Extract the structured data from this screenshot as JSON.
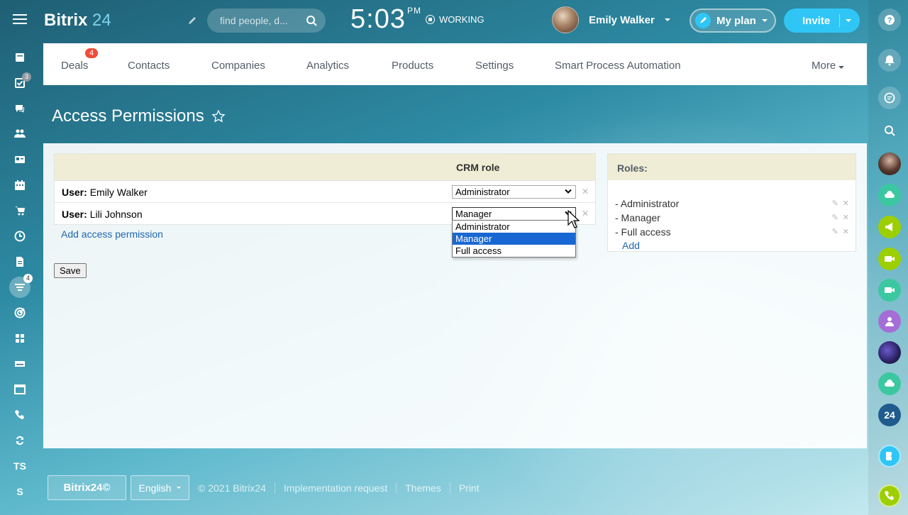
{
  "app": {
    "logo_main": "Bitrix",
    "logo_num": "24"
  },
  "header": {
    "search_placeholder": "find people, d...",
    "clock_time": "5:03",
    "clock_ampm": "PM",
    "work_status": "WORKING",
    "user_name": "Emily Walker",
    "myplan_label": "My plan",
    "invite_label": "Invite"
  },
  "left_sidebar": {
    "tasks_badge": "3",
    "funnel_badge": "4",
    "ts_label": "TS",
    "s_label": "S"
  },
  "nav": {
    "tabs": [
      {
        "label": "Deals",
        "badge": "4"
      },
      {
        "label": "Contacts"
      },
      {
        "label": "Companies"
      },
      {
        "label": "Analytics"
      },
      {
        "label": "Products"
      },
      {
        "label": "Settings"
      },
      {
        "label": "Smart Process Automation"
      }
    ],
    "more_label": "More"
  },
  "page": {
    "title": "Access Permissions"
  },
  "permissions": {
    "column_header": "CRM role",
    "rows": [
      {
        "user_prefix": "User:",
        "user_name": "Emily Walker",
        "role": "Administrator"
      },
      {
        "user_prefix": "User:",
        "user_name": "Lili Johnson",
        "role": "Manager"
      }
    ],
    "add_label": "Add access permission",
    "save_label": "Save",
    "dropdown_options": [
      "Administrator",
      "Manager",
      "Full access"
    ],
    "dropdown_selected": "Manager"
  },
  "roles": {
    "header": "Roles:",
    "items": [
      "- Administrator",
      "- Manager",
      "- Full access"
    ],
    "add_label": "Add"
  },
  "right_bar": {
    "b24_label": "24"
  },
  "footer": {
    "logo_label": "Bitrix24©",
    "language": "English",
    "copyright": "© 2021 Bitrix24",
    "links": [
      "Implementation request",
      "Themes",
      "Print"
    ]
  },
  "colors": {
    "accent": "#2fc6f6",
    "badge_red": "#f04c3a",
    "link_blue": "#2067b0",
    "table_head": "#efedd5",
    "dropdown_selected": "#1967d2"
  }
}
